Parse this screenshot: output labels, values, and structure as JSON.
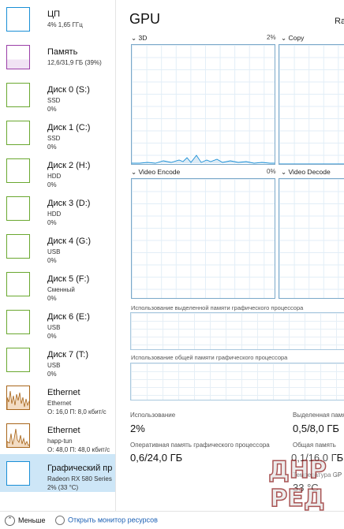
{
  "sidebar": {
    "items": [
      {
        "name": "ЦП",
        "line2": "4% 1,65 ГГц",
        "line3": "",
        "color": "#1a8fd6"
      },
      {
        "name": "Память",
        "line2": "12,6/31,9 ГБ (39%)",
        "line3": "",
        "color": "#9b3fa8"
      },
      {
        "name": "Диск 0 (S:)",
        "line2": "SSD",
        "line3": "0%",
        "color": "#6aa830"
      },
      {
        "name": "Диск 1 (C:)",
        "line2": "SSD",
        "line3": "0%",
        "color": "#6aa830"
      },
      {
        "name": "Диск 2 (H:)",
        "line2": "HDD",
        "line3": "0%",
        "color": "#6aa830"
      },
      {
        "name": "Диск 3 (D:)",
        "line2": "HDD",
        "line3": "0%",
        "color": "#6aa830"
      },
      {
        "name": "Диск 4 (G:)",
        "line2": "USB",
        "line3": "0%",
        "color": "#6aa830"
      },
      {
        "name": "Диск 5 (F:)",
        "line2": "Сменный",
        "line3": "0%",
        "color": "#6aa830"
      },
      {
        "name": "Диск 6 (E:)",
        "line2": "USB",
        "line3": "0%",
        "color": "#6aa830"
      },
      {
        "name": "Диск 7 (T:)",
        "line2": "USB",
        "line3": "0%",
        "color": "#6aa830"
      },
      {
        "name": "Ethernet",
        "line2": "Ethernet",
        "line3": "О: 16,0 П: 8,0 кбит/с",
        "color": "#a8651a"
      },
      {
        "name": "Ethernet",
        "line2": "happ-tun",
        "line3": "О: 48,0 П: 48,0 кбит/с",
        "color": "#a8651a"
      },
      {
        "name": "Графический пр",
        "line2": "Radeon RX 580 Series",
        "line3": "2% (33 °C)",
        "color": "#1a8fd6"
      }
    ]
  },
  "main": {
    "title": "GPU",
    "model": "Ra",
    "engines": [
      {
        "label": "3D",
        "pct": "2%"
      },
      {
        "label": "Copy",
        "pct": ""
      },
      {
        "label": "Video Encode",
        "pct": "0%"
      },
      {
        "label": "Video Decode",
        "pct": ""
      }
    ],
    "dedicated_label": "Использование выделенной памяти графического процессора",
    "shared_label": "Использование общей памяти графического процессора",
    "stats": {
      "usage_label": "Использование",
      "usage_value": "2%",
      "dedicated_mem_label": "Выделенная память",
      "dedicated_mem_value": "0,5/8,0 ГБ",
      "gpu_mem_label": "Оперативная память графического процессора",
      "gpu_mem_value": "0,6/24,0 ГБ",
      "shared_mem_label": "Общая память",
      "shared_mem_value": "0,1/16,0 ГБ",
      "temp_label": "Температура GP",
      "temp_value": "33 °C"
    }
  },
  "footer": {
    "fewer_label": "Меньше",
    "monitor_label": "Открыть монитор ресурсов"
  },
  "watermark": {
    "line1": "ДНР",
    "line2": "РЕД"
  }
}
